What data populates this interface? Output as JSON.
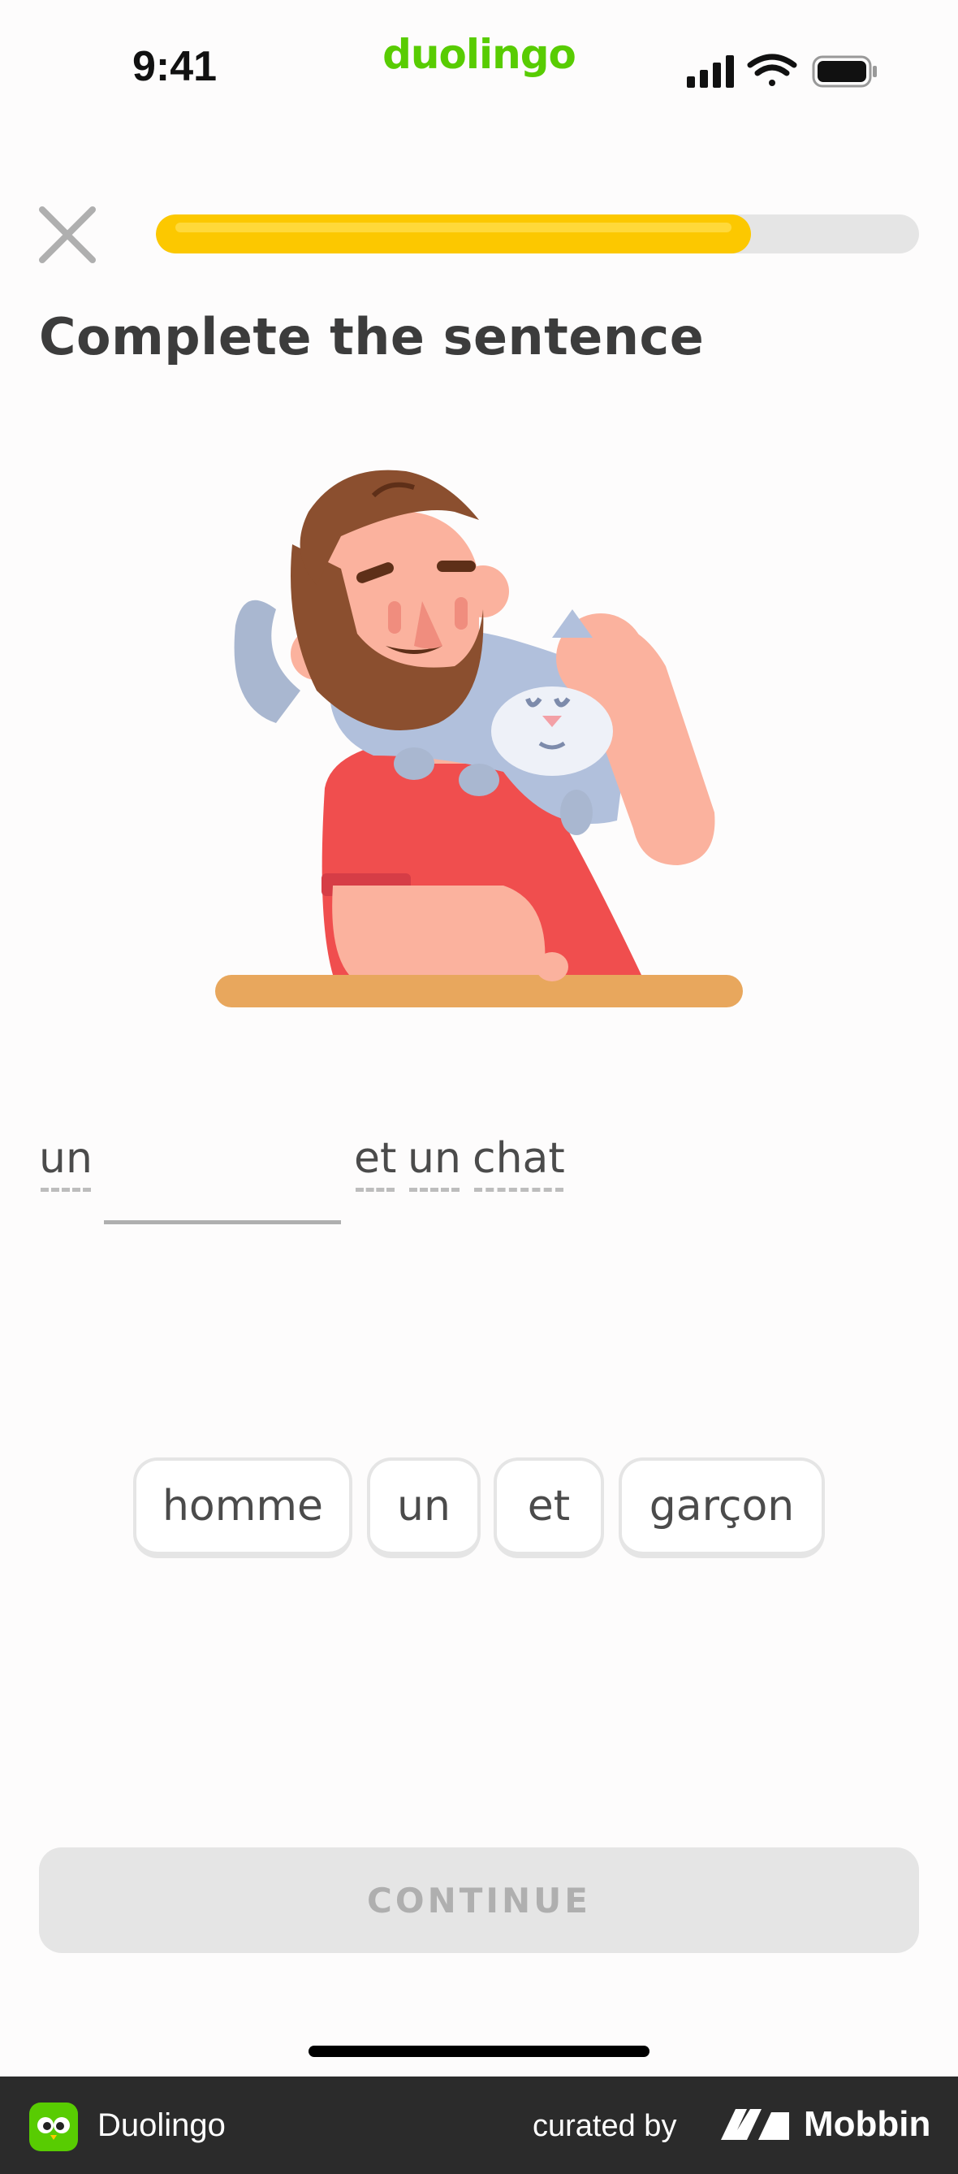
{
  "status_bar": {
    "time": "9:41",
    "icons": [
      "signal-icon",
      "wifi-icon",
      "battery-icon"
    ]
  },
  "brand": "duolingo",
  "header": {
    "close_icon": "close-icon",
    "progress": 0.78,
    "colors": {
      "fill": "#fcc800",
      "track": "#e5e5e5"
    }
  },
  "exercise": {
    "title": "Complete the sentence",
    "illustration": "man-hugging-cat-illustration",
    "sentence": {
      "before": [
        "un"
      ],
      "after": [
        "et",
        "un",
        "chat"
      ]
    },
    "word_bank": [
      "homme",
      "un",
      "et",
      "garçon"
    ]
  },
  "continue_label": "CONTINUE",
  "footer": {
    "app_name": "Duolingo",
    "curated_by": "curated by",
    "brand": "Mobbin"
  },
  "colors": {
    "accent": "#58cc02",
    "disabled_button": "#e5e5e5",
    "footer_bg": "#2b2b2b"
  }
}
